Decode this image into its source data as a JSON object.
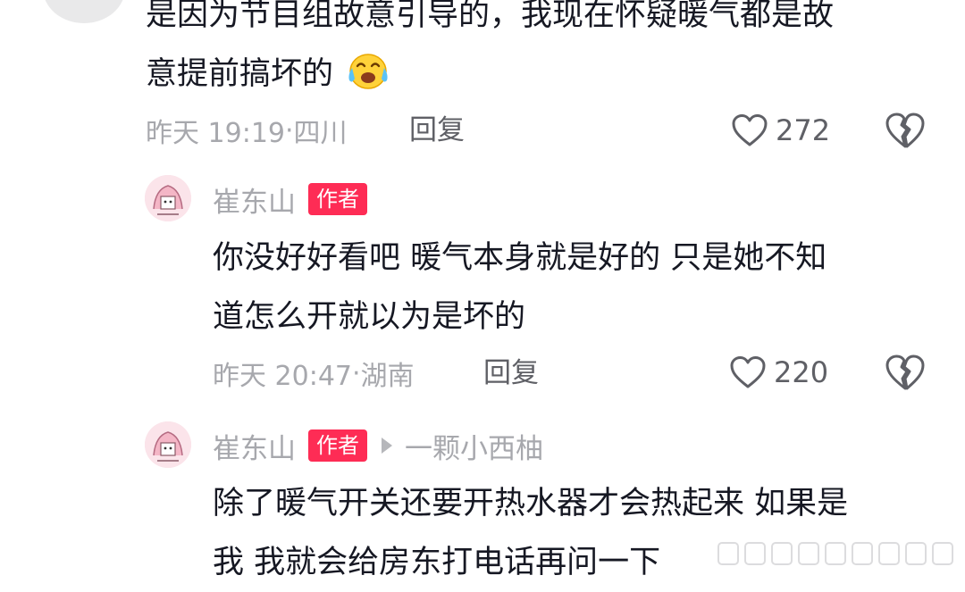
{
  "comments": [
    {
      "text_lines": [
        "是因为节目组故意引导的，我现在怀疑暖气都是故",
        "意提前搞坏的"
      ],
      "emoji": "crying-laughing-emoji",
      "time": "昨天 19:19",
      "location": "四川",
      "reply_label": "回复",
      "likes": "272"
    }
  ],
  "replies": [
    {
      "username": "崔东山",
      "badge": "作者",
      "text_lines": [
        "你没好好看吧 暖气本身就是好的 只是她不知",
        "道怎么开就以为是坏的"
      ],
      "time": "昨天 20:47",
      "location": "湖南",
      "reply_label": "回复",
      "likes": "220"
    },
    {
      "username": "崔东山",
      "badge": "作者",
      "reply_to": "一颗小西柚",
      "text_lines": [
        "除了暖气开关还要开热水器才会热起来 如果是",
        "我 我就会给房东打电话再问一下"
      ]
    }
  ],
  "colors": {
    "text": "#161823",
    "meta": "#a7a8ad",
    "action": "#5f6066",
    "badge": "#fe2c55"
  },
  "icons": {
    "like": "heart-outline-icon",
    "dislike": "broken-heart-icon"
  }
}
